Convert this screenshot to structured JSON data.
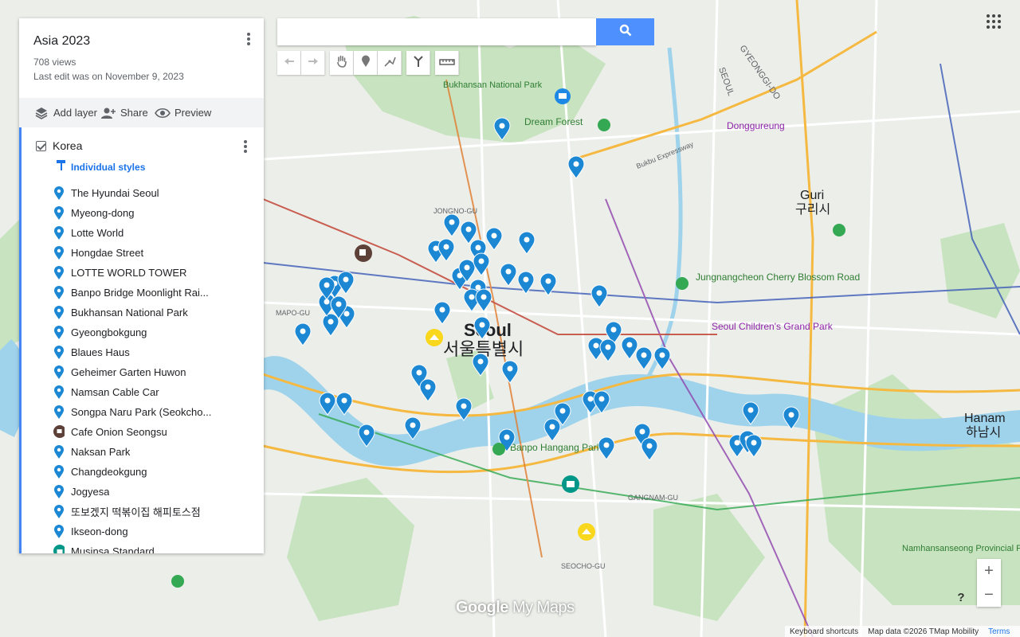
{
  "map": {
    "title": "Asia 2023",
    "views": "708 views",
    "last_edit": "Last edit was on November 9, 2023"
  },
  "actions": {
    "add_layer": "Add layer",
    "share": "Share",
    "preview": "Preview"
  },
  "layer": {
    "name": "Korea",
    "styles_label": "Individual styles",
    "items": [
      {
        "label": "The Hyundai Seoul",
        "icon": "pin-icon"
      },
      {
        "label": "Myeong-dong",
        "icon": "pin-icon"
      },
      {
        "label": "Lotte World",
        "icon": "pin-icon"
      },
      {
        "label": "Hongdae Street",
        "icon": "pin-icon"
      },
      {
        "label": "LOTTE WORLD TOWER",
        "icon": "pin-icon"
      },
      {
        "label": "Banpo Bridge Moonlight Rai...",
        "icon": "pin-icon"
      },
      {
        "label": "Bukhansan National Park",
        "icon": "pin-icon"
      },
      {
        "label": "Gyeongbokgung",
        "icon": "pin-icon"
      },
      {
        "label": "Blaues Haus",
        "icon": "pin-icon"
      },
      {
        "label": "Geheimer Garten Huwon",
        "icon": "pin-icon"
      },
      {
        "label": "Namsan Cable Car",
        "icon": "pin-icon"
      },
      {
        "label": "Songpa Naru Park (Seokcho...",
        "icon": "pin-icon"
      },
      {
        "label": "Cafe Onion Seongsu",
        "icon": "cafe-icon"
      },
      {
        "label": "Naksan Park",
        "icon": "pin-icon"
      },
      {
        "label": "Changdeokgung",
        "icon": "pin-icon"
      },
      {
        "label": "Jogyesa",
        "icon": "pin-icon"
      },
      {
        "label": "또보겠지 떡볶이집 해피토스점",
        "icon": "pin-icon"
      },
      {
        "label": "Ikseon-dong",
        "icon": "pin-icon"
      },
      {
        "label": "Musinsa Standard",
        "icon": "shop-icon"
      }
    ]
  },
  "search": {
    "value": "",
    "placeholder": ""
  },
  "map_labels": {
    "seoul_en": "Seoul",
    "seoul_ko": "서울특별시",
    "guri_en": "Guri",
    "guri_ko": "구리시",
    "hanam_en": "Hanam",
    "hanam_ko": "하남시",
    "bukhansan": "Bukhansan National Park",
    "dream_forest": "Dream Forest",
    "donggureung": "Donggureung",
    "childrens_grand_park": "Seoul Children's Grand Park",
    "jungnangcheon": "Jungnangcheon Cherry Blossom Road",
    "banpo_park": "Banpo Hangang Park",
    "namhansanseong": "Namhansanseong Provincial Park",
    "gyeonggi_do": "GYEONGGI-DO",
    "seoul_road": "SEOUL",
    "bukbu_expressway": "Bukbu Expressway",
    "gangnam_gu": "GANGNAM-GU",
    "mapo_gu": "MAPO-GU",
    "seocho_gu": "SEOCHO-GU",
    "jongno_gu": "JONGNO-GU"
  },
  "branding": {
    "logo_google": "Google",
    "logo_mymaps": "My Maps"
  },
  "footer": {
    "shortcuts": "Keyboard shortcuts",
    "data": "Map data ©2026 TMap Mobility",
    "terms": "Terms"
  },
  "colors": {
    "accent": "#1a73e8",
    "pin": "#1c88d4",
    "water": "#9fd3ec",
    "park": "#b9dcb1",
    "highway": "#f5b942"
  }
}
